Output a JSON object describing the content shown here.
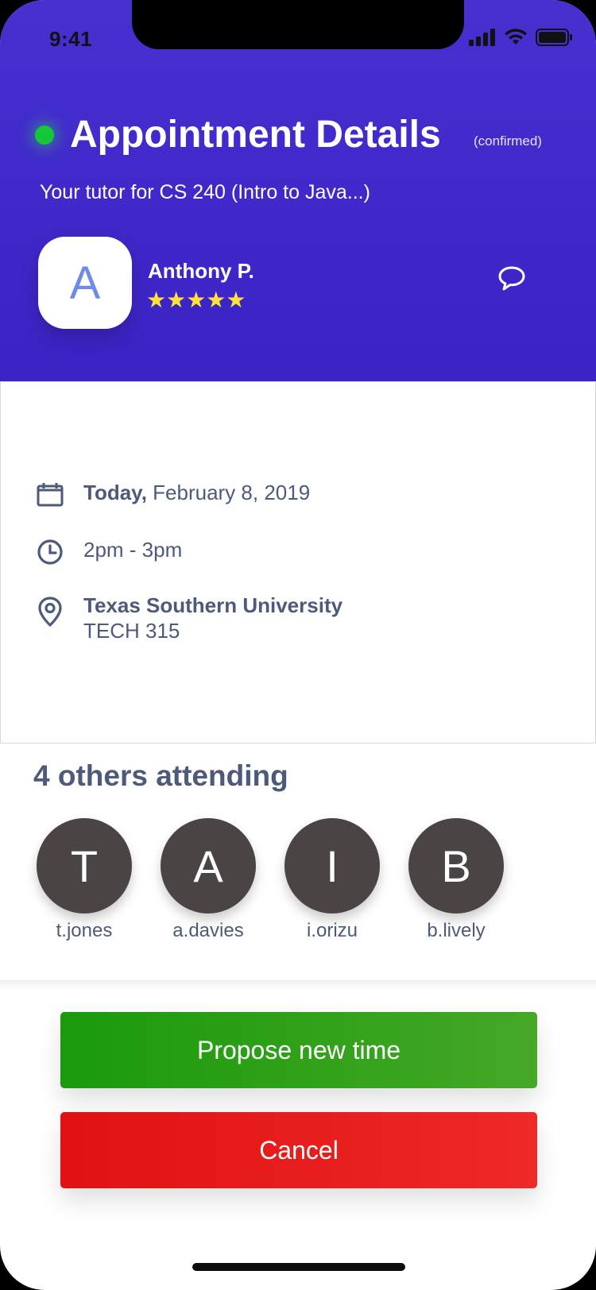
{
  "status_bar": {
    "time": "9:41"
  },
  "header": {
    "title": "Appointment Details",
    "status": "(confirmed)",
    "subtitle": "Your tutor for CS 240 (Intro to Java...)",
    "tutor": {
      "initial": "A",
      "name": "Anthony P.",
      "rating": 5,
      "stars": "★★★★★"
    }
  },
  "details": {
    "date_bold": "Today,",
    "date_rest": " February 8, 2019",
    "time": "2pm - 3pm",
    "location_name": "Texas Southern University",
    "location_room": "TECH 315"
  },
  "attending": {
    "title": "4 others attending",
    "people": [
      {
        "initial": "T",
        "name": "t.jones"
      },
      {
        "initial": "A",
        "name": "a.davies"
      },
      {
        "initial": "I",
        "name": "i.orizu"
      },
      {
        "initial": "B",
        "name": "b.lively"
      }
    ]
  },
  "actions": {
    "propose_label": "Propose new time",
    "cancel_label": "Cancel"
  },
  "colors": {
    "header": "#3f28cc",
    "online": "#14c83a",
    "propose": "#2aa018",
    "cancel": "#e61a1a",
    "text": "#4e5a7a",
    "star": "#ffe236",
    "attendee_avatar": "#4a4444"
  },
  "icons": [
    "cellular-signal-icon",
    "wifi-icon",
    "battery-icon",
    "chat-bubble-icon",
    "calendar-icon",
    "clock-icon",
    "location-pin-icon"
  ]
}
